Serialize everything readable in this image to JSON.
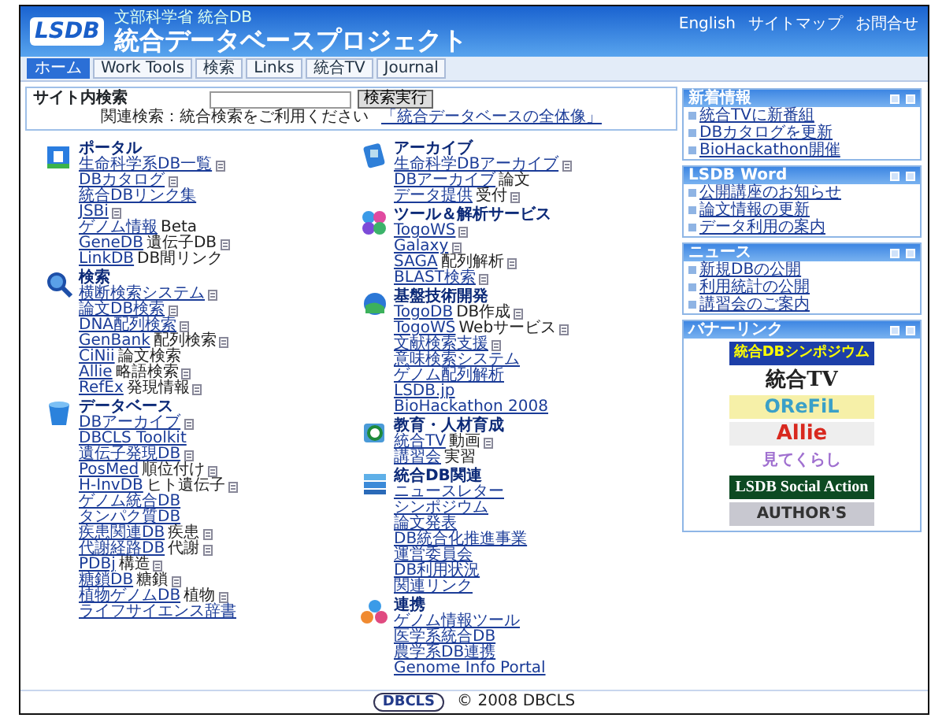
{
  "header": {
    "logo": "LSDB",
    "subtitle": "文部科学省 統合DB",
    "title": "統合データベースプロジェクト",
    "links": [
      "English",
      "サイトマップ",
      "お問合せ"
    ]
  },
  "tabs": [
    {
      "label": "ホーム",
      "selected": true
    },
    {
      "label": "Work Tools",
      "selected": false
    },
    {
      "label": "検索",
      "selected": false
    },
    {
      "label": "Links",
      "selected": false
    },
    {
      "label": "統合TV",
      "selected": false
    },
    {
      "label": "Journal",
      "selected": false
    }
  ],
  "search": {
    "title": "サイト内検索",
    "button": "検索実行",
    "note": "関連検索：統合検索をご利用ください",
    "link": "「統合データベースの全体像」"
  },
  "columns": [
    [
      {
        "title": "ポータル",
        "kind": "portal",
        "items": [
          {
            "text": "生命科学系DB一覧",
            "doc": true
          },
          {
            "text": "DBカタログ",
            "doc": true
          },
          {
            "text": "統合DBリンク集",
            "doc": false
          },
          {
            "text": "JSBi",
            "doc": true
          },
          {
            "text": "ゲノム情報",
            "note": "Beta",
            "doc": false
          },
          {
            "text": "GeneDB",
            "note": "遺伝子DB",
            "doc": true
          },
          {
            "text": "LinkDB",
            "note": "DB間リンク",
            "doc": false
          }
        ]
      },
      {
        "title": "検索",
        "kind": "search",
        "items": [
          {
            "text": "横断検索システム",
            "doc": true
          },
          {
            "text": "論文DB検索",
            "doc": true
          },
          {
            "text": "DNA配列検索",
            "doc": true
          },
          {
            "text": "GenBank",
            "note": "配列検索",
            "doc": true
          },
          {
            "text": "CiNii",
            "note": "論文検索",
            "doc": false
          },
          {
            "text": "Allie",
            "note": "略語検索",
            "doc": true
          },
          {
            "text": "RefEx",
            "note": "発現情報",
            "doc": true
          }
        ]
      },
      {
        "title": "データベース",
        "kind": "database",
        "items": [
          {
            "text": "DBアーカイブ",
            "doc": true
          },
          {
            "text": "DBCLS Toolkit",
            "doc": false
          },
          {
            "text": "遺伝子発現DB",
            "doc": true
          },
          {
            "text": "PosMed",
            "note": "順位付け",
            "doc": true
          },
          {
            "text": "H-InvDB",
            "note": "ヒト遺伝子",
            "doc": true
          },
          {
            "text": "ゲノム統合DB",
            "doc": false
          },
          {
            "text": "タンパク質DB",
            "doc": false
          },
          {
            "text": "疾患関連DB",
            "note": "疾患",
            "doc": true
          },
          {
            "text": "代謝経路DB",
            "note": "代謝",
            "doc": true
          },
          {
            "text": "PDBj",
            "note": "構造",
            "doc": true
          },
          {
            "text": "糖鎖DB",
            "note": "糖鎖",
            "doc": true
          },
          {
            "text": "植物ゲノムDB",
            "note": "植物",
            "doc": true
          },
          {
            "text": "ライフサイエンス辞書",
            "doc": false
          }
        ]
      }
    ],
    [
      {
        "title": "アーカイブ",
        "kind": "archive",
        "items": [
          {
            "text": "生命科学DBアーカイブ",
            "doc": true
          },
          {
            "text": "DBアーカイブ",
            "note": "論文",
            "doc": false
          },
          {
            "text": "データ提供",
            "note": "受付",
            "doc": true
          }
        ]
      },
      {
        "title": "ツール＆解析サービス",
        "kind": "tools",
        "items": [
          {
            "text": "TogoWS",
            "doc": true
          },
          {
            "text": "Galaxy",
            "doc": true
          },
          {
            "text": "SAGA",
            "note": "配列解析",
            "doc": true
          },
          {
            "text": "BLAST検索",
            "doc": true
          }
        ]
      },
      {
        "title": "基盤技術開発",
        "kind": "globe",
        "items": [
          {
            "text": "TogoDB",
            "note": "DB作成",
            "doc": true
          },
          {
            "text": "TogoWS",
            "note": "Webサービス",
            "doc": true
          },
          {
            "text": "文献検索支援",
            "doc": true
          },
          {
            "text": "意味検索システム",
            "doc": false
          },
          {
            "text": "ゲノム配列解析",
            "doc": false
          },
          {
            "text": "LSDB.jp",
            "doc": false
          },
          {
            "text": "BioHackathon 2008",
            "doc": false
          }
        ]
      },
      {
        "title": "教育・人材育成",
        "kind": "education",
        "items": [
          {
            "text": "統合TV",
            "note": "動画",
            "doc": true
          },
          {
            "text": "講習会",
            "note": "実習",
            "doc": false
          }
        ]
      },
      {
        "title": "統合DB関連",
        "kind": "books",
        "items": [
          {
            "text": "ニュースレター",
            "doc": false
          },
          {
            "text": "シンポジウム",
            "doc": false
          },
          {
            "text": "論文発表",
            "doc": false
          },
          {
            "text": "DB統合化推進事業",
            "doc": false
          },
          {
            "text": "運営委員会",
            "doc": false
          },
          {
            "text": "DB利用状況",
            "doc": false
          },
          {
            "text": "関連リンク",
            "doc": false
          }
        ]
      },
      {
        "title": "連携",
        "kind": "network",
        "items": [
          {
            "text": "ゲノム情報ツール",
            "doc": false
          },
          {
            "text": "医学系統合DB",
            "doc": false
          },
          {
            "text": "農学系DB連携",
            "doc": false
          },
          {
            "text": "Genome Info Portal",
            "doc": false
          }
        ]
      }
    ]
  ],
  "sidebar": [
    {
      "title": "新着情報",
      "items": [
        "統合TVに新番組",
        "DBカタログを更新",
        "BioHackathon開催"
      ]
    },
    {
      "title": "LSDB Word",
      "items": [
        "公開講座のお知らせ",
        "論文情報の更新",
        "データ利用の案内"
      ]
    },
    {
      "title": "ニュース",
      "items": [
        "新規DBの公開",
        "利用統計の公開",
        "講習会のご案内"
      ]
    }
  ],
  "banners": {
    "title": "バナーリンク",
    "items": [
      {
        "kind": "symposium",
        "text": "統合DBシンポジウム"
      },
      {
        "kind": "tv",
        "text": "統合TV"
      },
      {
        "kind": "orefil",
        "text": "OReFiL"
      },
      {
        "kind": "allie",
        "text": "Allie"
      },
      {
        "kind": "glasses",
        "text": "見てくらし"
      },
      {
        "kind": "social",
        "text": "LSDB Social Action"
      },
      {
        "kind": "authors",
        "text": "AUTHOR'S"
      }
    ]
  },
  "footer": {
    "logo": "DBCLS",
    "copyright": "© 2008 DBCLS"
  }
}
